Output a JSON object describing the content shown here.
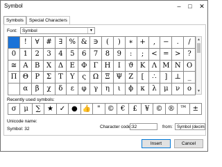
{
  "window": {
    "title": "Symbol",
    "minimize": "–",
    "maximize": "□",
    "close": "✕"
  },
  "tabs": [
    {
      "label": "Symbols"
    },
    {
      "label": "Special Characters"
    }
  ],
  "font": {
    "label": "Font:",
    "value": "Symbol"
  },
  "symbols": [
    [
      " ",
      "!",
      "∀",
      "#",
      "∃",
      "%",
      "&",
      "∋",
      "(",
      ")",
      "∗",
      "+",
      ",",
      "−",
      ".",
      "/"
    ],
    [
      "0",
      "1",
      "2",
      "3",
      "4",
      "5",
      "6",
      "7",
      "8",
      "9",
      ":",
      ";",
      "<",
      "=",
      ">",
      "?"
    ],
    [
      "≅",
      "Α",
      "Β",
      "Χ",
      "Δ",
      "Ε",
      "Φ",
      "Γ",
      "Η",
      "Ι",
      "ϑ",
      "Κ",
      "Λ",
      "Μ",
      "Ν",
      "Ο"
    ],
    [
      "Π",
      "Θ",
      "Ρ",
      "Σ",
      "Τ",
      "Υ",
      "ς",
      "Ω",
      "Ξ",
      "Ψ",
      "Ζ",
      "[",
      "∴",
      "]",
      "⊥",
      "_"
    ],
    [
      "",
      "α",
      "β",
      "χ",
      "δ",
      "ε",
      "φ",
      "γ",
      "η",
      "ι",
      "ϕ",
      "κ",
      "λ",
      "μ",
      "ν",
      "ο"
    ]
  ],
  "recent_label": "Recently used symbols:",
  "recent": [
    "σ",
    "μ",
    "∑",
    "★",
    "✓",
    "●",
    "👍",
    "\"",
    "©",
    "€",
    "£",
    "¥",
    "©",
    "®",
    "™",
    "±"
  ],
  "unicode_name_label": "Unicode name:",
  "unicode_value": "Symbol: 32",
  "character_code_label": "Character code:",
  "character_code_value": "32",
  "from_label": "from:",
  "from_value": "Symbol (decimal)",
  "buttons": {
    "insert": "Insert",
    "cancel": "Cancel"
  },
  "colors": {
    "selection": "#1b73d8"
  }
}
